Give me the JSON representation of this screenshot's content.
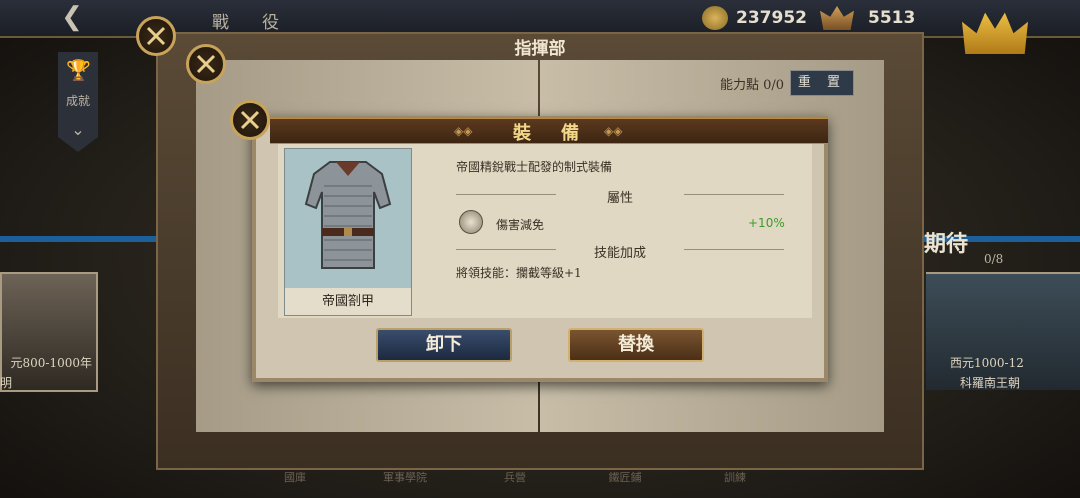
{
  "topbar": {
    "title": "戰　役",
    "coins": "237952",
    "gems": "5513"
  },
  "sidebar": {
    "achievement_label": "成就"
  },
  "book": {
    "title": "指揮部",
    "ability_points_label": "能力點 0/0",
    "reset_label": "重 置"
  },
  "background": {
    "left_card_caption": "元800-1000年",
    "left_card_sub": "明",
    "right_heading": "期待",
    "right_count": "0/8",
    "right_card_caption": "西元1000-12",
    "right_card_label": "科羅南王朝",
    "footer_tabs": [
      "國庫",
      "軍事學院",
      "兵營",
      "鐵匠鋪",
      "訓練"
    ]
  },
  "dialog": {
    "title": "裝　備",
    "item_name": "帝國劄甲",
    "description": "帝國精銳戰士配發的制式裝備",
    "attributes_heading": "屬性",
    "attributes": [
      {
        "name": "傷害減免",
        "value": "+10%",
        "icon": "shield-icon"
      }
    ],
    "skill_heading": "技能加成",
    "skill_text": "將領技能：攔截等級+1",
    "unequip_label": "卸下",
    "replace_label": "替換"
  },
  "colors": {
    "accent_gold": "#c8a35a",
    "bonus_green": "#3e9a2b",
    "header_brown": "#4a2f16",
    "unequip_blue": "#2a3a55"
  }
}
